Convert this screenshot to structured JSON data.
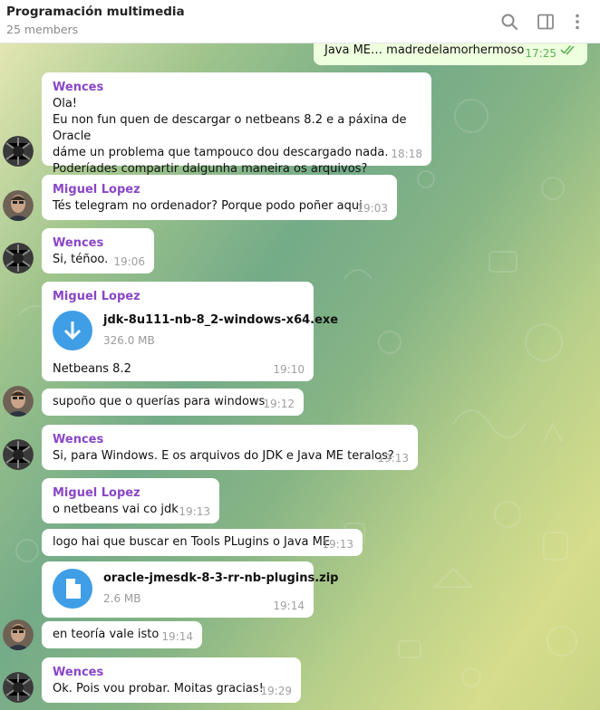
{
  "header": {
    "title": "Programación multimedia",
    "members": "25 members",
    "icons": [
      "search-icon",
      "sidebar-toggle-icon",
      "more-vertical-icon"
    ]
  },
  "colors": {
    "sender_wences": "#8a46c6",
    "sender_miguel": "#8a46c6",
    "file_icon": "#3f9ee6",
    "outgoing_bubble": "#eeffde",
    "check_marks": "#5fb158"
  },
  "messages": {
    "m0": {
      "text": "Java ME… madredelamorhermoso",
      "time": "17:25"
    },
    "m1": {
      "sender": "Wences",
      "text": "Ola!\nEu non fun quen de descargar o netbeans 8.2 e a páxina de Oracle\ndáme un problema que tampouco dou descargado nada.\nPoderíades compartir dalgunha maneira os arquivos?",
      "time": "18:18"
    },
    "m2": {
      "sender": "Miguel Lopez",
      "text": "Tés telegram no ordenador? Porque podo poñer aqui",
      "time": "19:03"
    },
    "m3": {
      "sender": "Wences",
      "text": "Si, téñoo.",
      "time": "19:06"
    },
    "m4": {
      "sender": "Miguel Lopez",
      "file_name": "jdk-8u111-nb-8_2-windows-x64.exe",
      "file_size": "326.0 MB",
      "caption": "Netbeans 8.2",
      "time": "19:10"
    },
    "m5": {
      "text": "supoño que o querías para windows",
      "time": "19:12"
    },
    "m6": {
      "sender": "Wences",
      "text": "Si, para Windows. E os arquivos do JDK e Java ME teralos?",
      "time": "19:13"
    },
    "m7": {
      "sender": "Miguel Lopez",
      "text": "o netbeans vai co jdk",
      "time": "19:13"
    },
    "m8": {
      "text": "logo hai que buscar en Tools PLugins o Java ME",
      "time": "19:13"
    },
    "m9": {
      "file_name": "oracle-jmesdk-8-3-rr-nb-plugins.zip",
      "file_size": "2.6 MB",
      "time": "19:14"
    },
    "m10": {
      "text": "en teoría vale isto",
      "time": "19:14"
    },
    "m11": {
      "sender": "Wences",
      "text": "Ok. Pois vou probar. Moitas gracias!",
      "time": "19:29"
    }
  }
}
